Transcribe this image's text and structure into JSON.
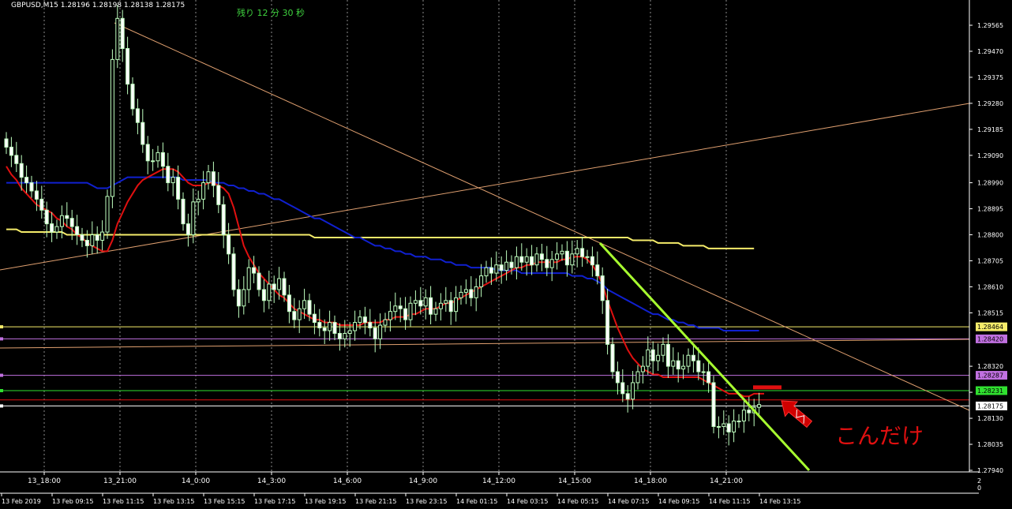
{
  "header": {
    "symbol_info": "GBPUSD,M15  1.28196 1.28198 1.28138 1.28175",
    "countdown": "残り 12 分 30 秒"
  },
  "annotation": {
    "text": "こんだけ",
    "color": "#e01010"
  },
  "colors": {
    "background": "#000000",
    "grid": "#c8c8c8",
    "bull_candle": "#000000",
    "bear_candle": "#ffffff",
    "candle_outline": "#bfffbf",
    "ma_red": "#e01010",
    "ma_blue": "#1020d0",
    "ma_yellow": "#f5ec6a",
    "trendline_tan": "#e0a070",
    "trendline_green": "#a8ff30"
  },
  "chart_data": {
    "type": "candlestick",
    "title": "GBPUSD,M15",
    "ylim": [
      1.2794,
      1.29565
    ],
    "yticks": [
      "1.29565",
      "1.29470",
      "1.29375",
      "1.29280",
      "1.29185",
      "1.29090",
      "1.28990",
      "1.28895",
      "1.28800",
      "1.28705",
      "1.28610",
      "1.28515",
      "1.28320",
      "1.28225",
      "1.28130",
      "1.28035",
      "1.27940"
    ],
    "xticks": [
      "13_18:00",
      "13_21:00",
      "14_0:00",
      "14_3:00",
      "14_6:00",
      "14_9:00",
      "14_12:00",
      "14_15:00",
      "14_18:00",
      "14_21:00"
    ],
    "xdates": [
      "13 Feb 2019",
      "13 Feb 09:15",
      "13 Feb 11:15",
      "13 Feb 13:15",
      "13 Feb 15:15",
      "13 Feb 17:15",
      "13 Feb 19:15",
      "13 Feb 21:15",
      "13 Feb 23:15",
      "14 Feb 01:15",
      "14 Feb 03:15",
      "14 Feb 05:15",
      "14 Feb 07:15",
      "14 Feb 09:15",
      "14 Feb 11:15",
      "14 Feb 13:15"
    ],
    "bottom_right_marks": [
      "2",
      "0"
    ],
    "price_tags": [
      {
        "price": 1.28464,
        "label": "1.28464",
        "bg": "#f5ec6a",
        "fg": "#000000",
        "line": "#f5ec6a"
      },
      {
        "price": 1.2842,
        "label": "1.28420",
        "bg": "#c070e0",
        "fg": "#000000",
        "line": "#c070e0"
      },
      {
        "price": 1.28287,
        "label": "1.28287",
        "bg": "#c070e0",
        "fg": "#000000",
        "line": "#c070e0"
      },
      {
        "price": 1.28231,
        "label": "1.28231",
        "bg": "#30e030",
        "fg": "#000000",
        "line": "#30e030"
      },
      {
        "price": 1.28175,
        "label": "1.28175",
        "bg": "#ffffff",
        "fg": "#000000",
        "line": "#ffffff"
      }
    ],
    "red_level_price": 1.28197,
    "red_marker_price": 1.28243,
    "candles_close": [
      1.2912,
      1.2909,
      1.2906,
      1.2901,
      1.2899,
      1.2896,
      1.2893,
      1.2889,
      1.2884,
      1.2881,
      1.2883,
      1.2887,
      1.2886,
      1.2883,
      1.288,
      1.2878,
      1.2876,
      1.288,
      1.2878,
      1.2881,
      1.2894,
      1.2944,
      1.2959,
      1.2948,
      1.2935,
      1.2926,
      1.2921,
      1.2913,
      1.2907,
      1.2907,
      1.291,
      1.2905,
      1.2899,
      1.2901,
      1.2893,
      1.2884,
      1.288,
      1.2892,
      1.2893,
      1.2899,
      1.2903,
      1.2898,
      1.2891,
      1.288,
      1.2873,
      1.286,
      1.2854,
      1.286,
      1.2868,
      1.2866,
      1.286,
      1.2856,
      1.2862,
      1.286,
      1.2864,
      1.2858,
      1.2852,
      1.2849,
      1.2853,
      1.2856,
      1.2851,
      1.2848,
      1.2846,
      1.2845,
      1.2848,
      1.2844,
      1.2842,
      1.2844,
      1.2845,
      1.2848,
      1.285,
      1.2848,
      1.2846,
      1.2842,
      1.2847,
      1.2849,
      1.2852,
      1.2854,
      1.2853,
      1.2849,
      1.2855,
      1.2856,
      1.2854,
      1.2857,
      1.2851,
      1.2853,
      1.2855,
      1.2856,
      1.2852,
      1.2857,
      1.2859,
      1.286,
      1.2857,
      1.2861,
      1.2865,
      1.2868,
      1.2866,
      1.2869,
      1.2867,
      1.287,
      1.2868,
      1.2872,
      1.287,
      1.2872,
      1.2869,
      1.2873,
      1.2871,
      1.2868,
      1.2871,
      1.2873,
      1.2874,
      1.2869,
      1.2873,
      1.2875,
      1.2872,
      1.2872,
      1.2869,
      1.2865,
      1.2856,
      1.284,
      1.283,
      1.2826,
      1.2822,
      1.282,
      1.2826,
      1.283,
      1.2832,
      1.2838,
      1.2834,
      1.2836,
      1.284,
      1.2832,
      1.2834,
      1.2831,
      1.2832,
      1.2836,
      1.2834,
      1.283,
      1.283,
      1.2826,
      1.281,
      1.281,
      1.2811,
      1.2808,
      1.2812,
      1.2812,
      1.2816,
      1.2815,
      1.2817,
      1.2818
    ],
    "ma_red": [
      1.2905,
      1.2902,
      1.29,
      1.2897,
      1.2895,
      1.2893,
      1.2891,
      1.289,
      1.2889,
      1.2888,
      1.2886,
      1.2885,
      1.2883,
      1.2882,
      1.288,
      1.2879,
      1.2877,
      1.2876,
      1.2875,
      1.2874,
      1.2874,
      1.2878,
      1.2884,
      1.2888,
      1.2892,
      1.2895,
      1.2898,
      1.29,
      1.2901,
      1.2902,
      1.2903,
      1.2904,
      1.2904,
      1.2904,
      1.2903,
      1.2901,
      1.2899,
      1.2898,
      1.2898,
      1.2898,
      1.2899,
      1.2899,
      1.2898,
      1.2897,
      1.2895,
      1.289,
      1.2883,
      1.2876,
      1.2872,
      1.2869,
      1.2866,
      1.2864,
      1.2862,
      1.286,
      1.2858,
      1.2857,
      1.2855,
      1.2853,
      1.2852,
      1.2851,
      1.285,
      1.2849,
      1.2849,
      1.2848,
      1.2848,
      1.2848,
      1.2847,
      1.2847,
      1.2847,
      1.2847,
      1.2847,
      1.2848,
      1.2848,
      1.2848,
      1.2848,
      1.2849,
      1.2849,
      1.285,
      1.285,
      1.285,
      1.2851,
      1.2851,
      1.2852,
      1.2853,
      1.2853,
      1.2853,
      1.2854,
      1.2855,
      1.2855,
      1.2856,
      1.2857,
      1.2858,
      1.2859,
      1.286,
      1.2861,
      1.2862,
      1.2863,
      1.2864,
      1.2865,
      1.2866,
      1.2867,
      1.2868,
      1.2868,
      1.2869,
      1.2869,
      1.287,
      1.287,
      1.287,
      1.287,
      1.287,
      1.2871,
      1.2871,
      1.2872,
      1.2872,
      1.2872,
      1.2871,
      1.2869,
      1.2866,
      1.2862,
      1.2856,
      1.2851,
      1.2846,
      1.2842,
      1.2838,
      1.2835,
      1.2833,
      1.2831,
      1.283,
      1.2829,
      1.2829,
      1.2828,
      1.2828,
      1.2828,
      1.2828,
      1.2828,
      1.2828,
      1.2828,
      1.2828,
      1.2827,
      1.2826,
      1.2825,
      1.2824,
      1.2823,
      1.2822,
      1.2822,
      1.2822,
      1.2821,
      1.2821,
      1.2822,
      1.2822,
      1.2822
    ],
    "ma_blue": [
      1.2899,
      1.2899,
      1.2899,
      1.2899,
      1.2899,
      1.2899,
      1.2899,
      1.2899,
      1.2899,
      1.2899,
      1.2899,
      1.2899,
      1.2899,
      1.2899,
      1.2899,
      1.2899,
      1.2899,
      1.2898,
      1.2897,
      1.2897,
      1.2897,
      1.2898,
      1.2899,
      1.29,
      1.2901,
      1.2901,
      1.2901,
      1.2901,
      1.2901,
      1.2901,
      1.2901,
      1.2901,
      1.2901,
      1.2901,
      1.2901,
      1.29,
      1.29,
      1.29,
      1.29,
      1.29,
      1.29,
      1.2899,
      1.2899,
      1.2899,
      1.2898,
      1.2898,
      1.2897,
      1.2897,
      1.2896,
      1.2896,
      1.2895,
      1.2895,
      1.2894,
      1.2893,
      1.2893,
      1.2892,
      1.2891,
      1.289,
      1.2889,
      1.2888,
      1.2887,
      1.2886,
      1.2886,
      1.2885,
      1.2884,
      1.2883,
      1.2882,
      1.2881,
      1.288,
      1.2879,
      1.2879,
      1.2878,
      1.2877,
      1.2876,
      1.2876,
      1.2875,
      1.2875,
      1.2874,
      1.2874,
      1.2873,
      1.2873,
      1.2872,
      1.2872,
      1.2872,
      1.2871,
      1.2871,
      1.2871,
      1.287,
      1.287,
      1.2869,
      1.2869,
      1.2869,
      1.2868,
      1.2868,
      1.2868,
      1.2868,
      1.2868,
      1.2867,
      1.2867,
      1.2867,
      1.2867,
      1.2867,
      1.2866,
      1.2866,
      1.2866,
      1.2866,
      1.2866,
      1.2866,
      1.2866,
      1.2866,
      1.2866,
      1.2866,
      1.2865,
      1.2865,
      1.2865,
      1.2864,
      1.2864,
      1.2863,
      1.2862,
      1.286,
      1.2859,
      1.2858,
      1.2857,
      1.2856,
      1.2855,
      1.2854,
      1.2853,
      1.2852,
      1.2851,
      1.2851,
      1.285,
      1.2849,
      1.2849,
      1.2848,
      1.2848,
      1.2847,
      1.2847,
      1.2846,
      1.2846,
      1.2846,
      1.2846,
      1.2846,
      1.2845,
      1.2845,
      1.2845,
      1.2845,
      1.2845,
      1.2845,
      1.2845,
      1.2845
    ],
    "ma_yellow": [
      1.2882,
      1.2882,
      1.2882,
      1.2881,
      1.2881,
      1.2881,
      1.2881,
      1.2881,
      1.2881,
      1.2881,
      1.2881,
      1.2881,
      1.288,
      1.288,
      1.288,
      1.288,
      1.288,
      1.288,
      1.288,
      1.288,
      1.288,
      1.288,
      1.288,
      1.288,
      1.288,
      1.288,
      1.288,
      1.288,
      1.288,
      1.288,
      1.288,
      1.288,
      1.288,
      1.288,
      1.288,
      1.288,
      1.288,
      1.288,
      1.288,
      1.288,
      1.288,
      1.288,
      1.288,
      1.288,
      1.288,
      1.288,
      1.288,
      1.288,
      1.288,
      1.288,
      1.288,
      1.288,
      1.288,
      1.288,
      1.288,
      1.288,
      1.288,
      1.288,
      1.288,
      1.288,
      1.288,
      1.2879,
      1.2879,
      1.2879,
      1.2879,
      1.2879,
      1.2879,
      1.2879,
      1.2879,
      1.2879,
      1.2879,
      1.2879,
      1.2879,
      1.2879,
      1.2879,
      1.2879,
      1.2879,
      1.2879,
      1.2879,
      1.2879,
      1.2879,
      1.2879,
      1.2879,
      1.2879,
      1.2879,
      1.2879,
      1.2879,
      1.2879,
      1.2879,
      1.2879,
      1.2879,
      1.2879,
      1.2879,
      1.2879,
      1.2879,
      1.2879,
      1.2879,
      1.2879,
      1.2879,
      1.2879,
      1.2879,
      1.2879,
      1.2879,
      1.2879,
      1.2879,
      1.2879,
      1.2879,
      1.2879,
      1.2879,
      1.2879,
      1.2879,
      1.2879,
      1.2879,
      1.2879,
      1.2879,
      1.2879,
      1.2879,
      1.2879,
      1.2879,
      1.2879,
      1.2879,
      1.2879,
      1.2879,
      1.2879,
      1.2878,
      1.2878,
      1.2878,
      1.2878,
      1.2878,
      1.2877,
      1.2877,
      1.2877,
      1.2877,
      1.2877,
      1.2876,
      1.2876,
      1.2876,
      1.2876,
      1.2876,
      1.2875,
      1.2875,
      1.2875,
      1.2875,
      1.2875,
      1.2875,
      1.2875,
      1.2875,
      1.2875,
      1.2875
    ]
  }
}
